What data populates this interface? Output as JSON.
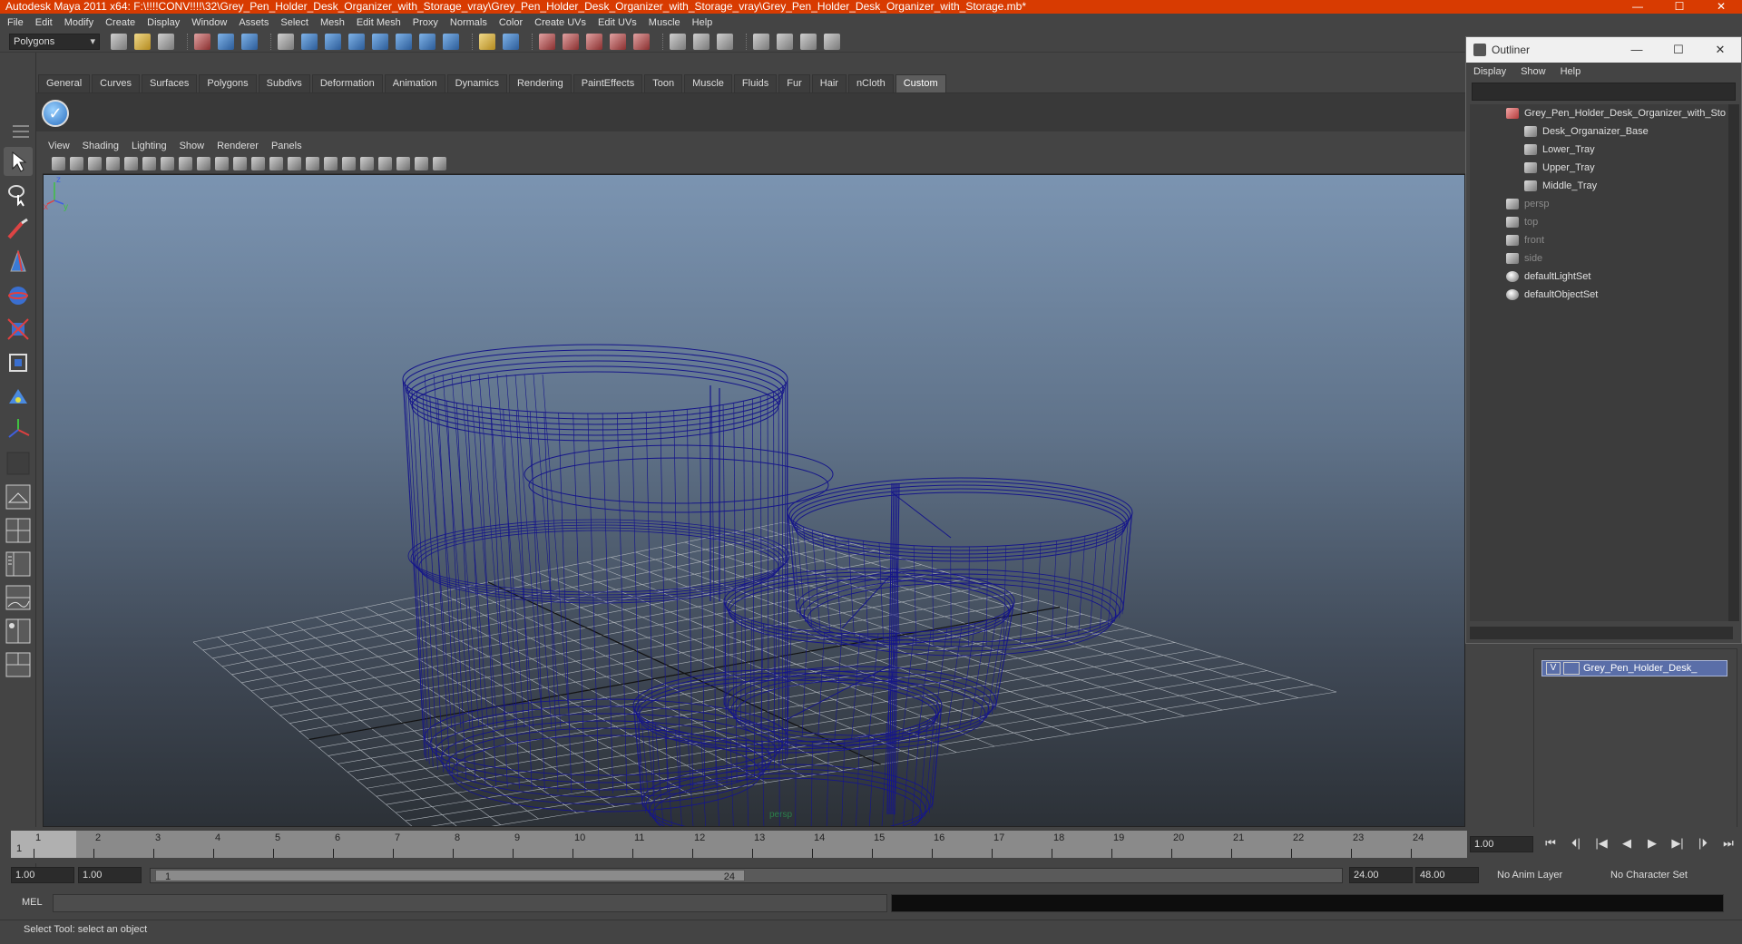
{
  "window": {
    "title": "Autodesk Maya 2011 x64: F:\\!!!!CONV!!!!\\32\\Grey_Pen_Holder_Desk_Organizer_with_Storage_vray\\Grey_Pen_Holder_Desk_Organizer_with_Storage_vray\\Grey_Pen_Holder_Desk_Organizer_with_Storage.mb*",
    "minimize": "—",
    "maximize": "☐",
    "close": "✕"
  },
  "menus": [
    "File",
    "Edit",
    "Modify",
    "Create",
    "Display",
    "Window",
    "Assets",
    "Select",
    "Mesh",
    "Edit Mesh",
    "Proxy",
    "Normals",
    "Color",
    "Create UVs",
    "Edit UVs",
    "Muscle",
    "Help"
  ],
  "status_line": {
    "mode": "Polygons"
  },
  "shelf": {
    "tabs": [
      "General",
      "Curves",
      "Surfaces",
      "Polygons",
      "Subdivs",
      "Deformation",
      "Animation",
      "Dynamics",
      "Rendering",
      "PaintEffects",
      "Toon",
      "Muscle",
      "Fluids",
      "Fur",
      "Hair",
      "nCloth",
      "Custom"
    ],
    "active_tab": "Custom",
    "check_glyph": "✓"
  },
  "viewport": {
    "menus": [
      "View",
      "Shading",
      "Lighting",
      "Show",
      "Renderer",
      "Panels"
    ],
    "camera_label": "persp",
    "axis": {
      "x": "x",
      "y": "y",
      "z": "z"
    },
    "wire_color": "#16168a"
  },
  "outliner": {
    "title": "Outliner",
    "menus": [
      "Display",
      "Show",
      "Help"
    ],
    "items": [
      {
        "label": "Grey_Pen_Holder_Desk_Organizer_with_Sto",
        "level": 0,
        "icon": "group-icon",
        "dim": false
      },
      {
        "label": "Desk_Organaizer_Base",
        "level": 1,
        "icon": "mesh-icon",
        "dim": false
      },
      {
        "label": "Lower_Tray",
        "level": 1,
        "icon": "mesh-icon",
        "dim": false
      },
      {
        "label": "Upper_Tray",
        "level": 1,
        "icon": "mesh-icon",
        "dim": false
      },
      {
        "label": "Middle_Tray",
        "level": 1,
        "icon": "mesh-icon",
        "dim": false
      },
      {
        "label": "persp",
        "level": 0,
        "icon": "camera-icon",
        "dim": true
      },
      {
        "label": "top",
        "level": 0,
        "icon": "camera-icon",
        "dim": true
      },
      {
        "label": "front",
        "level": 0,
        "icon": "camera-icon",
        "dim": true
      },
      {
        "label": "side",
        "level": 0,
        "icon": "camera-icon",
        "dim": true
      },
      {
        "label": "defaultLightSet",
        "level": 0,
        "icon": "set-icon",
        "dim": false
      },
      {
        "label": "defaultObjectSet",
        "level": 0,
        "icon": "set-icon",
        "dim": false
      }
    ]
  },
  "layers": {
    "rows": [
      {
        "visible": "V",
        "name": "Grey_Pen_Holder_Desk_"
      }
    ]
  },
  "timeline": {
    "ticks": [
      "1",
      "2",
      "3",
      "4",
      "5",
      "6",
      "7",
      "8",
      "9",
      "10",
      "11",
      "12",
      "13",
      "14",
      "15",
      "16",
      "17",
      "18",
      "19",
      "20",
      "21",
      "22",
      "23",
      "24"
    ],
    "current_frame": "1",
    "current_time": "1.00",
    "play_controls": [
      "⏮",
      "⏴|",
      "|◀",
      "◀",
      "▶",
      "▶|",
      "|⏵",
      "⏭"
    ]
  },
  "range": {
    "start": "1.00",
    "playback_start": "1.00",
    "slider_start": "1",
    "slider_end": "24",
    "playback_end": "24.00",
    "end": "48.00",
    "anim_layer": "No Anim Layer",
    "character_set": "No Character Set"
  },
  "command_line": {
    "label": "MEL"
  },
  "help_line": {
    "text": "Select Tool: select an object"
  }
}
